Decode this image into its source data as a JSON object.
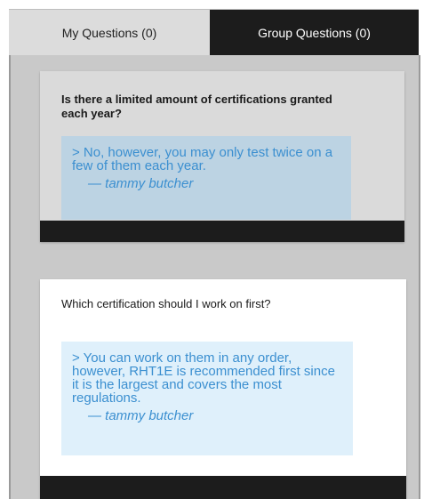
{
  "tabs": {
    "my_questions": "My Questions (0)",
    "group_questions": "Group Questions (0)"
  },
  "questions": [
    {
      "question": "Is there a limited amount of certifications granted each year?",
      "answer": "> No, however, you may only test twice on a few of them each year.",
      "author": "— tammy butcher"
    },
    {
      "question": "Which certification should I work on first?",
      "answer": "> You can work on them in any order, however, RHT1E is recommended first since it is the largest and covers the most regulations.",
      "author": "— tammy butcher"
    }
  ],
  "colors": {
    "active_tab_bg": "#1c1c1c",
    "inactive_tab_bg": "#dcdcdc",
    "answer_text": "#3b8fd0",
    "answer_bg": "#dff0fb"
  }
}
